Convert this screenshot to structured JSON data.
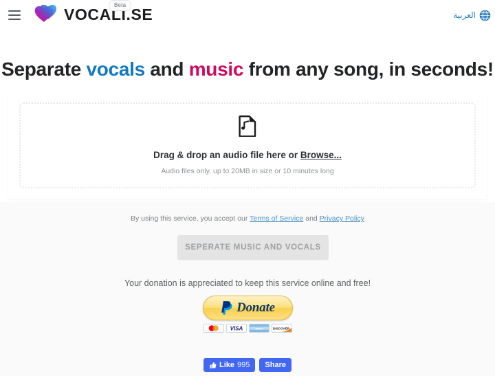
{
  "header": {
    "menu_icon": "hamburger-menu-icon",
    "brand_name": "VOCALI.SE",
    "beta_label": "Beta",
    "logo_icon": "vocalise-heart-logo",
    "language_label": "العربية",
    "language_icon": "globe-icon"
  },
  "hero": {
    "part1": "Separate ",
    "highlight_vocals": "vocals",
    "part2": " and ",
    "highlight_music": "music",
    "part3": " from any song, in seconds!"
  },
  "upload": {
    "file_icon": "audio-file-icon",
    "prompt_prefix": "Drag & drop an audio file here or ",
    "browse_label": "Browse...",
    "hint": "Audio files only, up to 20MB in size or 10 minutes long"
  },
  "legal": {
    "prefix": "By using this service, you accept our ",
    "terms_label": "Terms of Service",
    "conjunction": " and ",
    "privacy_label": "Privacy Policy"
  },
  "actions": {
    "separate_label": "SEPERATE MUSIC AND VOCALS"
  },
  "donation": {
    "text": "Your donation is appreciated to keep this service online and free!",
    "paypal_label": "Donate",
    "paypal_icon": "paypal-logo-icon",
    "cards": [
      {
        "name": "mastercard-logo",
        "label": "MasterCard"
      },
      {
        "name": "visa-logo",
        "label": "VISA"
      },
      {
        "name": "amex-logo",
        "label": "AMEX"
      },
      {
        "name": "discover-logo",
        "label": "DISCOVER"
      }
    ]
  },
  "social": {
    "like_label": "Like",
    "like_count": "995",
    "share_label": "Share",
    "thumb_icon": "thumbs-up-icon"
  },
  "colors": {
    "vocals_blue": "#1279bd",
    "music_pink": "#cf0a5d",
    "link_blue": "#4a90c4",
    "facebook_blue": "#4267f2",
    "paypal_gold": "#f9cf4e"
  }
}
